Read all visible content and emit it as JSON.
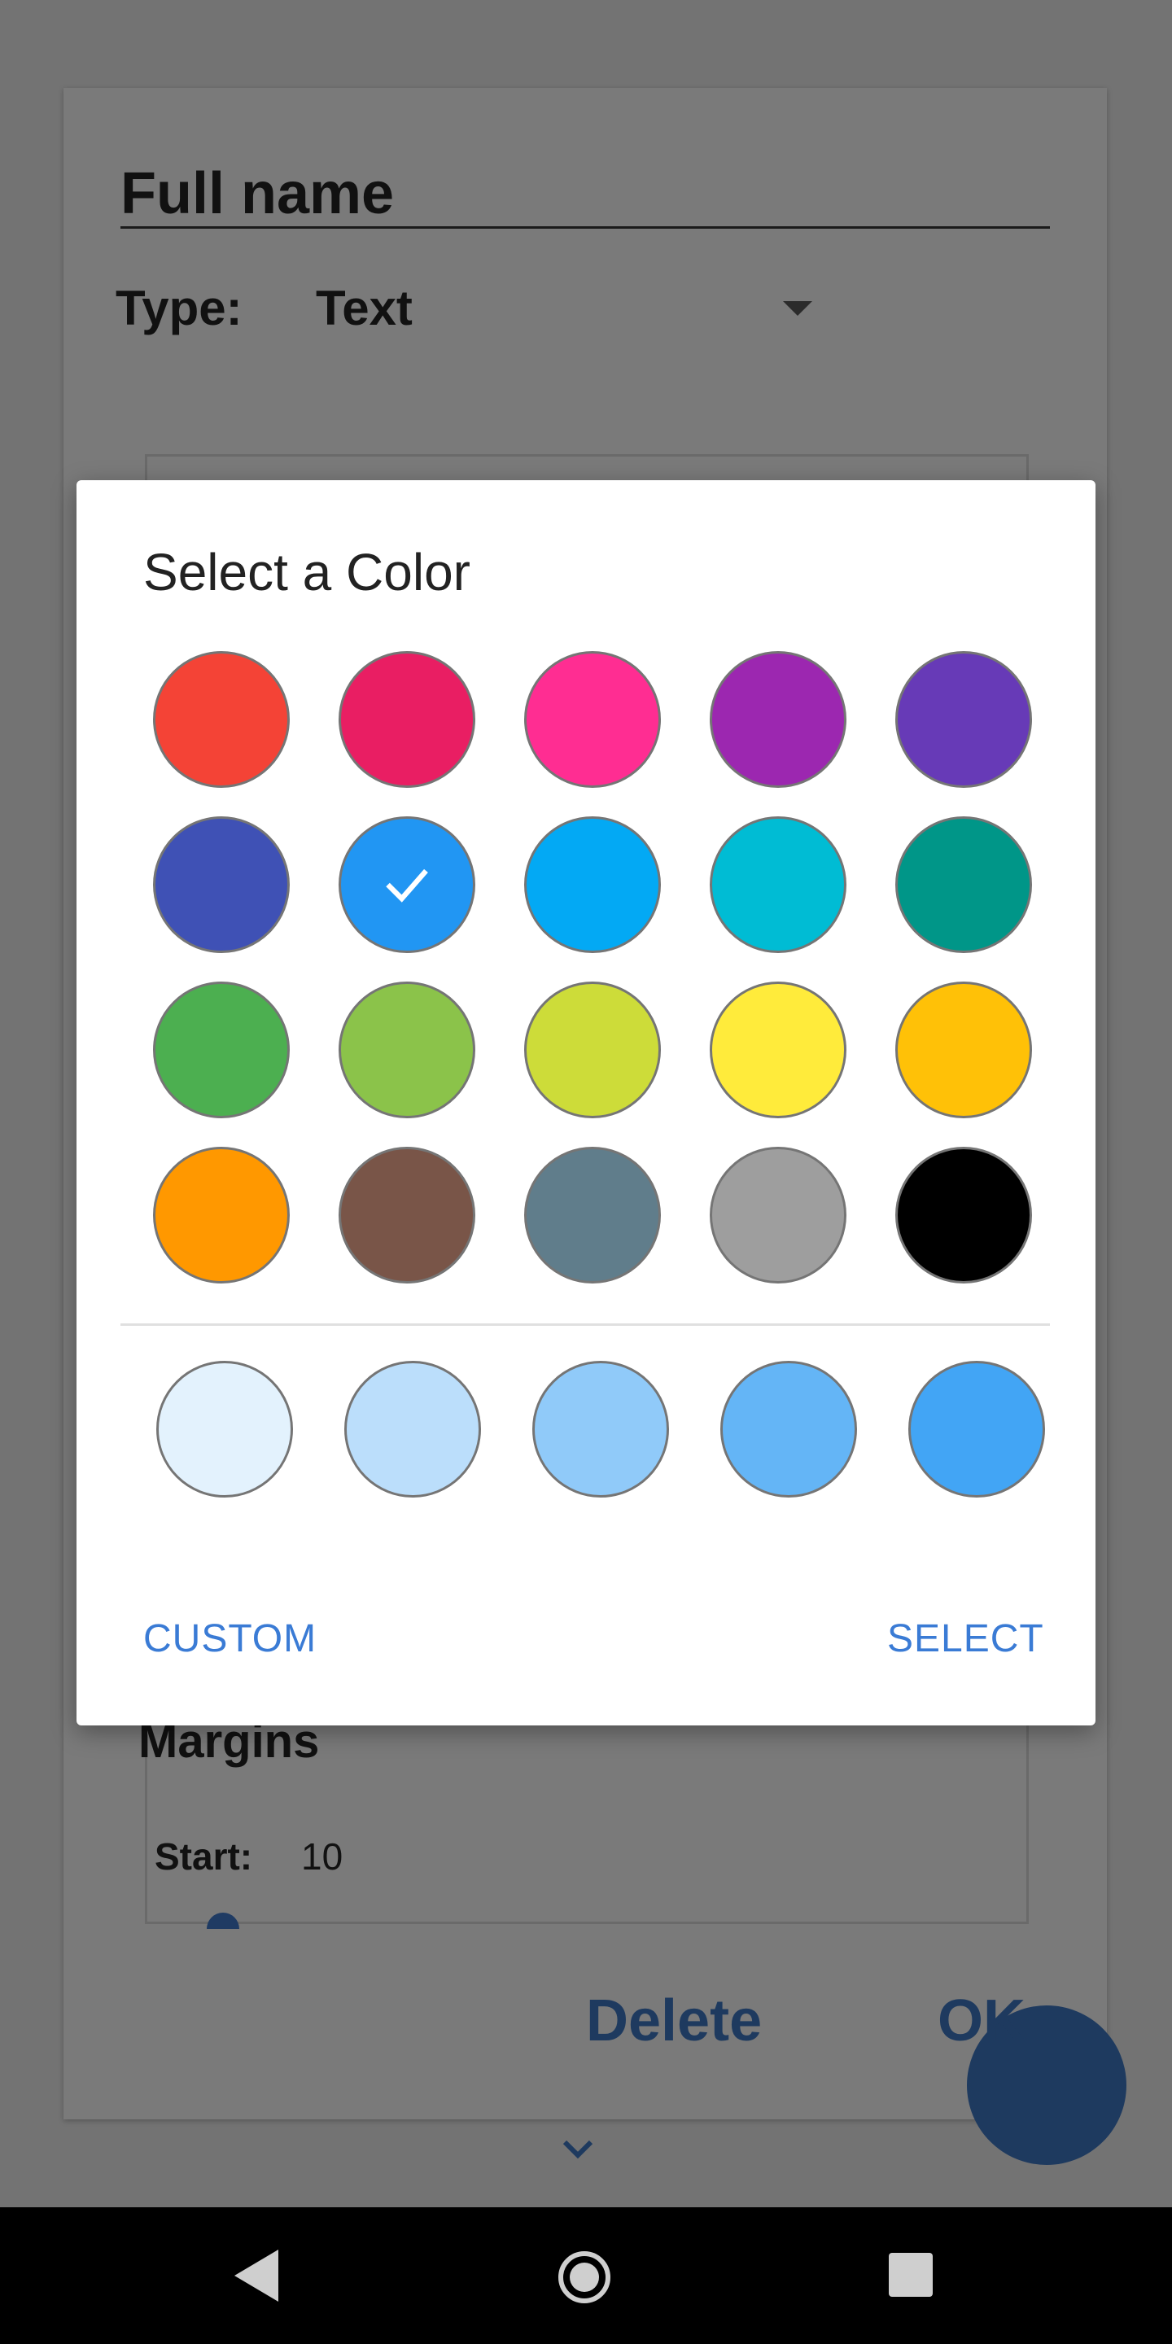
{
  "form": {
    "name_value": "Full name",
    "type_label": "Type:",
    "type_value": "Text",
    "margins_title": "Margins",
    "start_label": "Start:",
    "start_value": "10",
    "delete_label": "Delete",
    "ok_label": "OK"
  },
  "dialog": {
    "title": "Select a Color",
    "selected_index": 6,
    "colors": [
      "#F44336",
      "#E91E63",
      "#FF2D92",
      "#9C27B0",
      "#673AB7",
      "#3F51B5",
      "#2196F3",
      "#03A9F4",
      "#00BCD4",
      "#009688",
      "#4CAF50",
      "#8BC34A",
      "#CDDC39",
      "#FFEB3B",
      "#FFC107",
      "#FF9800",
      "#795548",
      "#607D8B",
      "#9E9E9E",
      "#000000"
    ],
    "shades": [
      "#E3F2FD",
      "#BBDEFB",
      "#90CAF9",
      "#64B5F6",
      "#42A5F5"
    ],
    "custom_label": "CUSTOM",
    "select_label": "SELECT"
  },
  "icons": {
    "dropdown": "dropdown-arrow-icon",
    "check": "check-icon",
    "chevron": "chevron-down-icon",
    "back": "back-icon",
    "home": "home-icon",
    "recent": "recent-apps-icon"
  }
}
